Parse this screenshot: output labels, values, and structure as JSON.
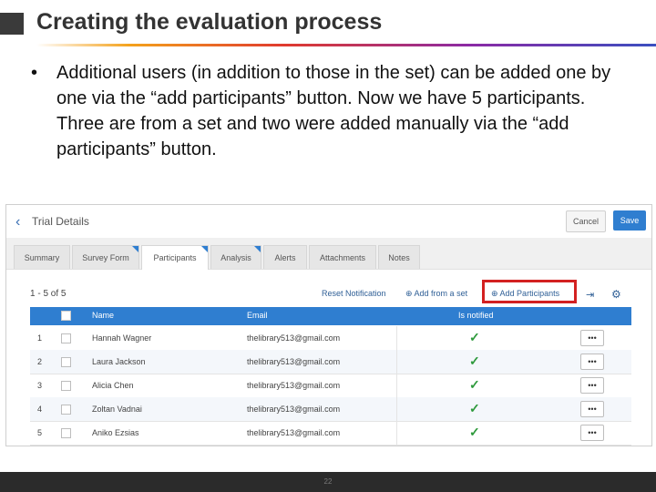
{
  "slide": {
    "title": "Creating the evaluation process",
    "bullet": "•",
    "body": "Additional users (in addition to those in the set) can be added one by one via the “add participants” button.  Now we have 5 participants.  Three are from a set and two were added manually via the “add participants” button.",
    "page_number": "22"
  },
  "screenshot": {
    "back_icon": "‹",
    "title": "Trial Details",
    "cancel_label": "Cancel",
    "save_label": "Save",
    "tabs": [
      "Summary",
      "Survey Form",
      "Participants",
      "Analysis",
      "Alerts",
      "Attachments",
      "Notes"
    ],
    "active_tab": "Participants",
    "count": "1 - 5 of 5",
    "reset_label": "Reset Notification",
    "add_set_label": "⊕ Add from a set",
    "add_participants_label": "⊕ Add Participants",
    "export_icon": "⇥",
    "settings_icon": "⚙",
    "columns": {
      "name": "Name",
      "email": "Email",
      "notified": "Is notified"
    },
    "rows": [
      {
        "n": "1",
        "name": "Hannah Wagner",
        "email": "thelibrary513@gmail.com",
        "notified": "✓",
        "more": "•••"
      },
      {
        "n": "2",
        "name": "Laura Jackson",
        "email": "thelibrary513@gmail.com",
        "notified": "✓",
        "more": "•••"
      },
      {
        "n": "3",
        "name": "Alicia Chen",
        "email": "thelibrary513@gmail.com",
        "notified": "✓",
        "more": "•••"
      },
      {
        "n": "4",
        "name": "Zoltan Vadnai",
        "email": "thelibrary513@gmail.com",
        "notified": "✓",
        "more": "•••"
      },
      {
        "n": "5",
        "name": "Aniko Ezsias",
        "email": "thelibrary513@gmail.com",
        "notified": "✓",
        "more": "•••"
      }
    ],
    "colors": {
      "accent": "#2f7ed0",
      "highlight": "#d32121",
      "check": "#2e9a3c"
    }
  }
}
